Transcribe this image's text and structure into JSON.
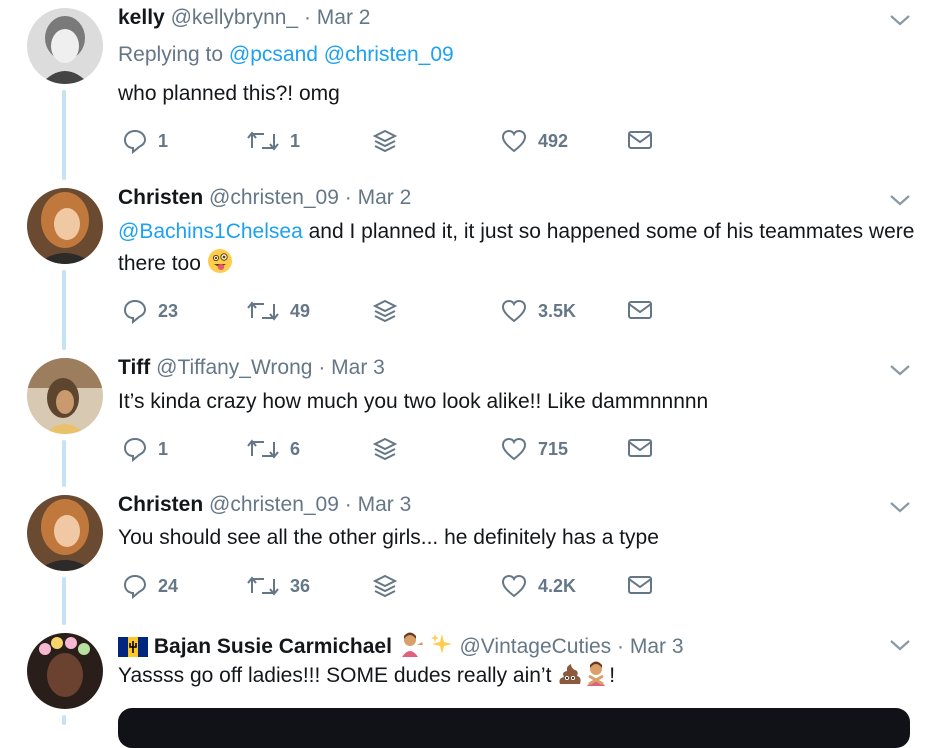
{
  "tweets": [
    {
      "name": "kelly",
      "handle": "@kellybrynn_",
      "separator": "·",
      "date": "Mar 2",
      "reply_prefix": "Replying to",
      "reply_mentions": [
        "@pcsand",
        "@christen_09"
      ],
      "text": "who planned this?! omg",
      "replies": "1",
      "retweets": "1",
      "likes": "492",
      "avatar_color": "#d8d8d8"
    },
    {
      "name": "Christen",
      "handle": "@christen_09",
      "separator": "·",
      "date": "Mar 2",
      "mention": "@Bachins1Chelsea",
      "text": " and I planned it, it just so happened some of his teammates were there too",
      "emoji": "winking-tongue-emoji",
      "replies": "23",
      "retweets": "49",
      "likes": "3.5K",
      "avatar_color": "#c8864e"
    },
    {
      "name": "Tiff",
      "handle": "@Tiffany_Wrong",
      "separator": "·",
      "date": "Mar 3",
      "text": "It’s kinda crazy how much you two look alike!! Like dammnnnnn",
      "replies": "1",
      "retweets": "6",
      "likes": "715",
      "avatar_color": "#8a6a48"
    },
    {
      "name": "Christen",
      "handle": "@christen_09",
      "separator": "·",
      "date": "Mar 3",
      "text": "You should see all the other girls... he definitely has a type",
      "replies": "24",
      "retweets": "36",
      "likes": "4.2K",
      "avatar_color": "#c8864e"
    },
    {
      "name": "Bajan Susie Carmichael",
      "handle": "@VintageCuties",
      "separator": "·",
      "date": "Mar 3",
      "text": "Yassss go off ladies!!! SOME dudes really ain’t",
      "text_end": "!",
      "name_emojis": [
        "barbados-flag-emoji",
        "person-tipping-hand-emoji",
        "sparkles-emoji"
      ],
      "text_emojis": [
        "pile-of-poo-emoji",
        "person-gesturing-no-emoji"
      ],
      "avatar_color": "#3a2a22"
    }
  ],
  "colors": {
    "link": "#1da1f2",
    "secondary": "#657786",
    "thread_line": "#c4e3f7"
  },
  "icons": [
    "reply-icon",
    "retweet-icon",
    "stack-icon",
    "like-icon",
    "message-icon",
    "chevron-down-icon"
  ]
}
